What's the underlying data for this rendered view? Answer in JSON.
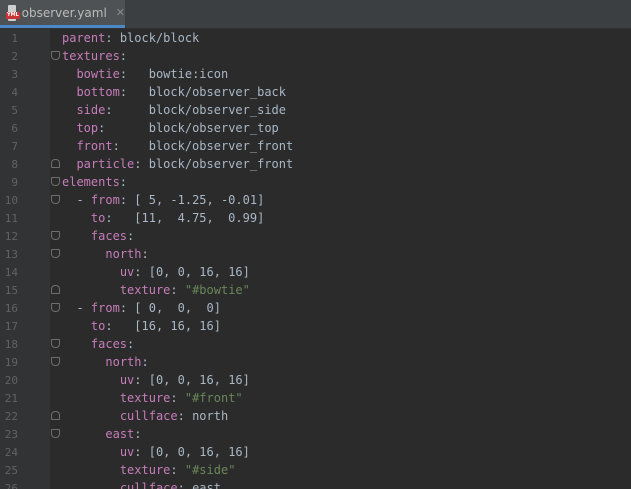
{
  "tab": {
    "filename": "observer.yaml",
    "icon_badge": "YML"
  },
  "lines": [
    {
      "n": "1",
      "indent": 0,
      "key": "parent",
      "sep": ": ",
      "val": "block/block",
      "vtype": "plain",
      "fold": ""
    },
    {
      "n": "2",
      "indent": 0,
      "key": "textures",
      "sep": ":",
      "val": "",
      "vtype": "plain",
      "fold": "open"
    },
    {
      "n": "3",
      "indent": 2,
      "key": "bowtie",
      "sep": ":   ",
      "val": "bowtie:icon",
      "vtype": "plain",
      "fold": ""
    },
    {
      "n": "4",
      "indent": 2,
      "key": "bottom",
      "sep": ":   ",
      "val": "block/observer_back",
      "vtype": "plain",
      "fold": ""
    },
    {
      "n": "5",
      "indent": 2,
      "key": "side",
      "sep": ":     ",
      "val": "block/observer_side",
      "vtype": "plain",
      "fold": ""
    },
    {
      "n": "6",
      "indent": 2,
      "key": "top",
      "sep": ":      ",
      "val": "block/observer_top",
      "vtype": "plain",
      "fold": ""
    },
    {
      "n": "7",
      "indent": 2,
      "key": "front",
      "sep": ":    ",
      "val": "block/observer_front",
      "vtype": "plain",
      "fold": ""
    },
    {
      "n": "8",
      "indent": 2,
      "key": "particle",
      "sep": ": ",
      "val": "block/observer_front",
      "vtype": "plain",
      "fold": "close"
    },
    {
      "n": "9",
      "indent": 0,
      "key": "elements",
      "sep": ":",
      "val": "",
      "vtype": "plain",
      "fold": "open"
    },
    {
      "n": "10",
      "indent": 2,
      "prefix": "- ",
      "key": "from",
      "sep": ": ",
      "val": "[ 5, -1.25, -0.01]",
      "vtype": "plain",
      "fold": "open"
    },
    {
      "n": "11",
      "indent": 4,
      "key": "to",
      "sep": ":   ",
      "val": "[11,  4.75,  0.99]",
      "vtype": "plain",
      "fold": ""
    },
    {
      "n": "12",
      "indent": 4,
      "key": "faces",
      "sep": ":",
      "val": "",
      "vtype": "plain",
      "fold": "open"
    },
    {
      "n": "13",
      "indent": 6,
      "key": "north",
      "sep": ":",
      "val": "",
      "vtype": "plain",
      "fold": "open"
    },
    {
      "n": "14",
      "indent": 8,
      "key": "uv",
      "sep": ": ",
      "val": "[0, 0, 16, 16]",
      "vtype": "plain",
      "fold": ""
    },
    {
      "n": "15",
      "indent": 8,
      "key": "texture",
      "sep": ": ",
      "val": "\"#bowtie\"",
      "vtype": "string",
      "fold": "close"
    },
    {
      "n": "16",
      "indent": 2,
      "prefix": "- ",
      "key": "from",
      "sep": ": ",
      "val": "[ 0,  0,  0]",
      "vtype": "plain",
      "fold": "open"
    },
    {
      "n": "17",
      "indent": 4,
      "key": "to",
      "sep": ":   ",
      "val": "[16, 16, 16]",
      "vtype": "plain",
      "fold": ""
    },
    {
      "n": "18",
      "indent": 4,
      "key": "faces",
      "sep": ":",
      "val": "",
      "vtype": "plain",
      "fold": "open"
    },
    {
      "n": "19",
      "indent": 6,
      "key": "north",
      "sep": ":",
      "val": "",
      "vtype": "plain",
      "fold": "open"
    },
    {
      "n": "20",
      "indent": 8,
      "key": "uv",
      "sep": ": ",
      "val": "[0, 0, 16, 16]",
      "vtype": "plain",
      "fold": ""
    },
    {
      "n": "21",
      "indent": 8,
      "key": "texture",
      "sep": ": ",
      "val": "\"#front\"",
      "vtype": "string",
      "fold": ""
    },
    {
      "n": "22",
      "indent": 8,
      "key": "cullface",
      "sep": ": ",
      "val": "north",
      "vtype": "plain",
      "fold": "close"
    },
    {
      "n": "23",
      "indent": 6,
      "key": "east",
      "sep": ":",
      "val": "",
      "vtype": "plain",
      "fold": "open"
    },
    {
      "n": "24",
      "indent": 8,
      "key": "uv",
      "sep": ": ",
      "val": "[0, 0, 16, 16]",
      "vtype": "plain",
      "fold": ""
    },
    {
      "n": "25",
      "indent": 8,
      "key": "texture",
      "sep": ": ",
      "val": "\"#side\"",
      "vtype": "string",
      "fold": ""
    },
    {
      "n": "26",
      "indent": 8,
      "key": "cullface",
      "sep": ": ",
      "val": "east",
      "vtype": "plain",
      "fold": ""
    }
  ],
  "colors": {
    "background": "#2b2b2b",
    "gutter": "#313335",
    "key": "#c77dbb",
    "text": "#a9b7c6",
    "string": "#6a8759",
    "line_number": "#606366",
    "tab_accent": "#4a88c7"
  }
}
